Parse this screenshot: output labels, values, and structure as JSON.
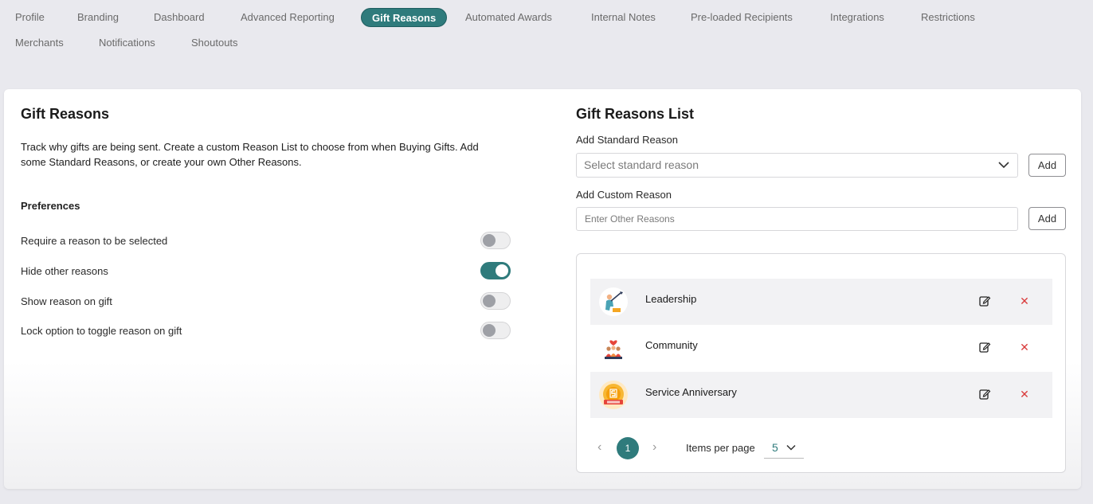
{
  "tabs": [
    {
      "label": "Profile",
      "active": false
    },
    {
      "label": "Branding",
      "active": false
    },
    {
      "label": "Dashboard",
      "active": false
    },
    {
      "label": "Advanced Reporting",
      "active": false
    },
    {
      "label": "Gift Reasons",
      "active": true
    },
    {
      "label": "Automated Awards",
      "active": false
    },
    {
      "label": "Internal Notes",
      "active": false
    },
    {
      "label": "Pre-loaded Recipients",
      "active": false
    },
    {
      "label": "Integrations",
      "active": false
    },
    {
      "label": "Restrictions",
      "active": false
    },
    {
      "label": "Merchants",
      "active": false
    },
    {
      "label": "Notifications",
      "active": false
    },
    {
      "label": "Shoutouts",
      "active": false
    }
  ],
  "left": {
    "title": "Gift Reasons",
    "description": "Track why gifts are being sent. Create a custom Reason List to choose from when Buying Gifts. Add some Standard Reasons, or create your own Other Reasons.",
    "preferences_title": "Preferences",
    "preferences": [
      {
        "label": "Require a reason to be selected",
        "on": false
      },
      {
        "label": "Hide other reasons",
        "on": true
      },
      {
        "label": "Show reason on gift",
        "on": false
      },
      {
        "label": "Lock option to toggle reason on gift",
        "on": false
      }
    ]
  },
  "right": {
    "title": "Gift Reasons List",
    "standard_label": "Add Standard Reason",
    "standard_placeholder": "Select standard reason",
    "add_label": "Add",
    "custom_label": "Add Custom Reason",
    "custom_placeholder": "Enter Other Reasons",
    "reasons": [
      {
        "name": "Leadership",
        "icon": "leadership-icon"
      },
      {
        "name": "Community",
        "icon": "community-icon"
      },
      {
        "name": "Service Anniversary",
        "icon": "service-anniversary-icon"
      }
    ],
    "pager": {
      "current_page": "1",
      "items_per_page_label": "Items per page",
      "items_per_page": "5"
    }
  },
  "colors": {
    "accent": "#2f7b7c",
    "delete": "#d93b3b",
    "background": "#e9e9ee"
  }
}
